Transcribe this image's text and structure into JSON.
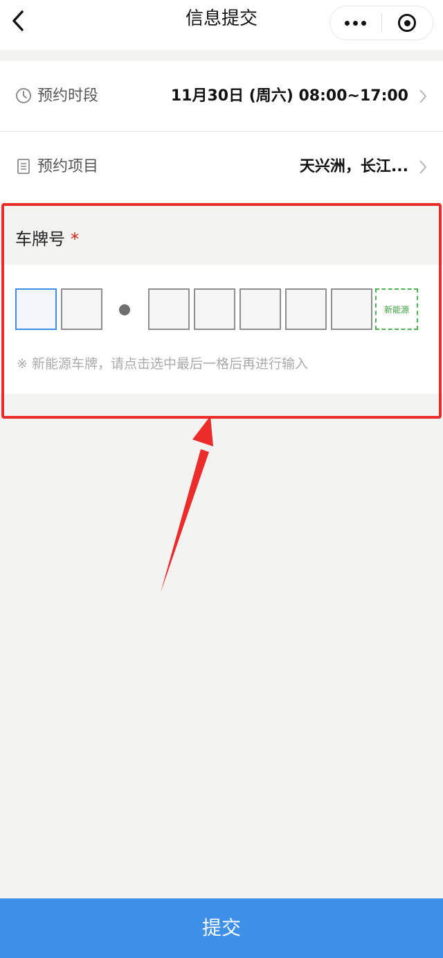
{
  "header": {
    "title": "信息提交"
  },
  "rows": [
    {
      "label": "预约时段",
      "value": "11月30日 (周六) 08:00~17:00",
      "icon": "clock-icon"
    },
    {
      "label": "预约项目",
      "value": "天兴洲，长江...",
      "icon": "list-icon"
    }
  ],
  "plate": {
    "label": "车牌号",
    "required_mark": "*",
    "new_energy_label": "新能源",
    "hint": "※ 新能源车牌，请点击选中最后一格后再进行输入"
  },
  "submit_label": "提交",
  "colors": {
    "accent": "#3d8fe8",
    "required": "#d81e06",
    "annotation": "#ec2b2b",
    "new_energy": "#3aa33a"
  }
}
